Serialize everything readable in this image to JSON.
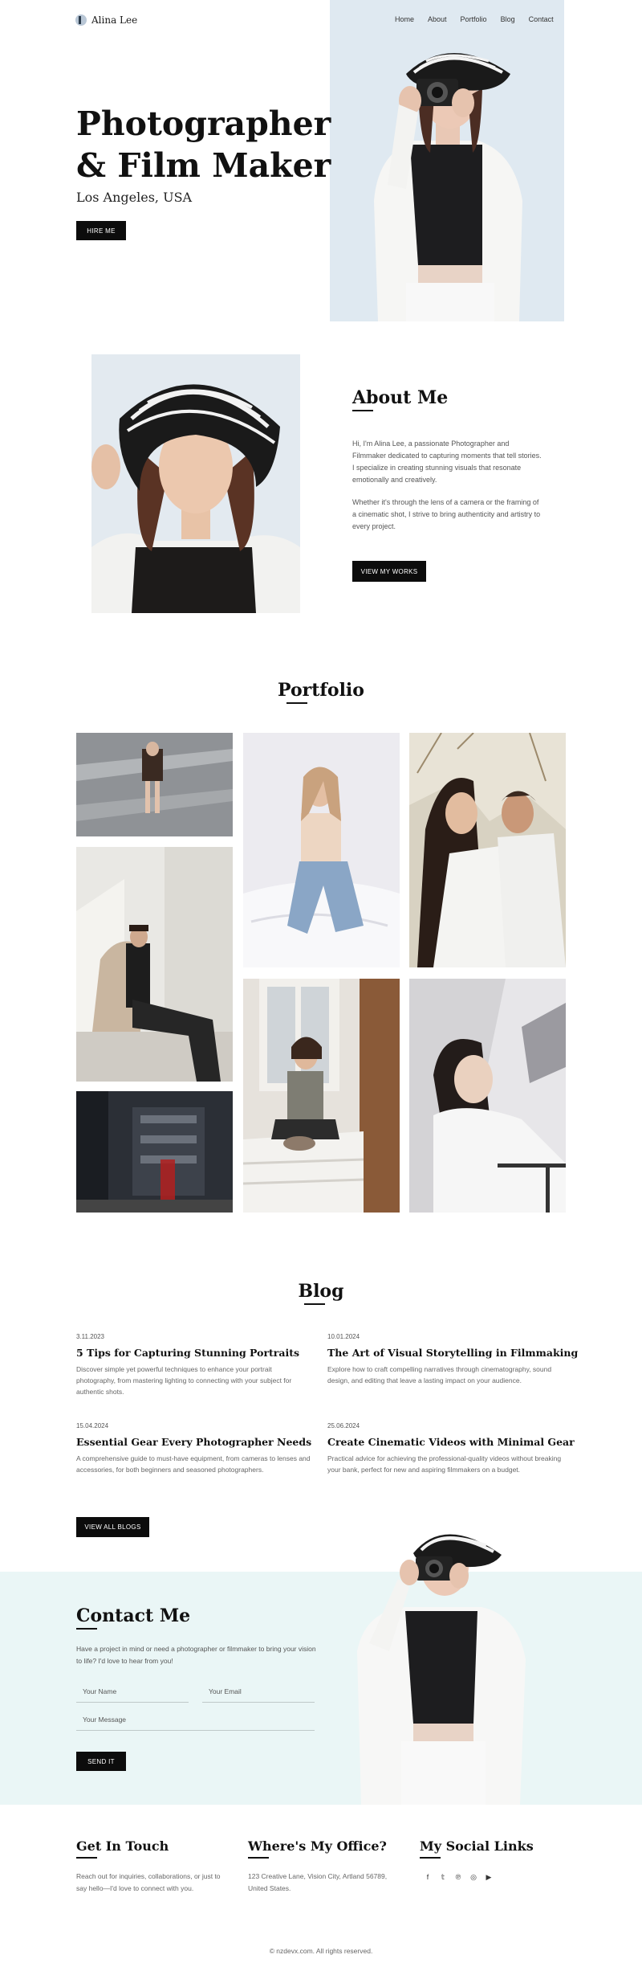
{
  "header": {
    "logo_text": "Alina Lee",
    "nav": [
      "Home",
      "About",
      "Portfolio",
      "Blog",
      "Contact"
    ]
  },
  "hero": {
    "title_line1": "Photographer",
    "title_line2": "& Film Maker",
    "subtitle": "Los Angeles, USA",
    "button": "HIRE ME"
  },
  "about": {
    "title": "About Me",
    "paragraph1": "Hi, I'm Alina Lee, a passionate Photographer and Filmmaker dedicated to capturing moments that tell stories. I specialize in creating stunning visuals that resonate emotionally and creatively.",
    "paragraph2": "Whether it's through the lens of a camera or the framing of a cinematic shot, I strive to bring authenticity and artistry to every project.",
    "button": "VIEW MY WORKS"
  },
  "portfolio": {
    "title": "Portfolio"
  },
  "blog": {
    "title": "Blog",
    "posts": [
      {
        "date": "3.11.2023",
        "title": "5 Tips for Capturing Stunning Portraits",
        "desc": "Discover simple yet powerful techniques to enhance your portrait photography, from mastering lighting to connecting with your subject for authentic shots."
      },
      {
        "date": "10.01.2024",
        "title": "The Art of Visual Storytelling in Filmmaking",
        "desc": "Explore how to craft compelling narratives through cinematography, sound design, and editing that leave a lasting impact on your audience."
      },
      {
        "date": "15.04.2024",
        "title": "Essential Gear Every Photographer Needs",
        "desc": "A comprehensive guide to must-have equipment, from cameras to lenses and accessories, for both beginners and seasoned photographers."
      },
      {
        "date": "25.06.2024",
        "title": "Create Cinematic Videos with Minimal Gear",
        "desc": "Practical advice for achieving the professional-quality videos without breaking your bank, perfect for new and aspiring filmmakers on a budget."
      }
    ],
    "button": "VIEW ALL BLOGS"
  },
  "contact": {
    "title": "Contact Me",
    "paragraph": "Have a project in mind or need a photographer or filmmaker to bring your vision to life? I'd love to hear from you!",
    "name_placeholder": "Your Name",
    "email_placeholder": "Your Email",
    "message_placeholder": "Your Message",
    "button": "SEND IT"
  },
  "footer": {
    "touch_title": "Get In Touch",
    "touch_text": "Reach out for inquiries, collaborations, or just to say hello—I'd love to connect with you.",
    "office_title": "Where's My Office?",
    "office_text": "123 Creative Lane, Vision City, Artland 56789, United States.",
    "social_title": "My Social Links",
    "social_icons": [
      "facebook-icon",
      "twitter-icon",
      "pinterest-icon",
      "instagram-icon",
      "youtube-icon"
    ],
    "social_glyphs": [
      "f",
      "𝕥",
      "℗",
      "◎",
      "▶"
    ],
    "copyright": "© nzdevx.com. All rights reserved."
  },
  "colors": {
    "accent": "#0c0c0c",
    "contact_band": "#eaf6f6",
    "hero_bg": "#e3ecf3"
  }
}
